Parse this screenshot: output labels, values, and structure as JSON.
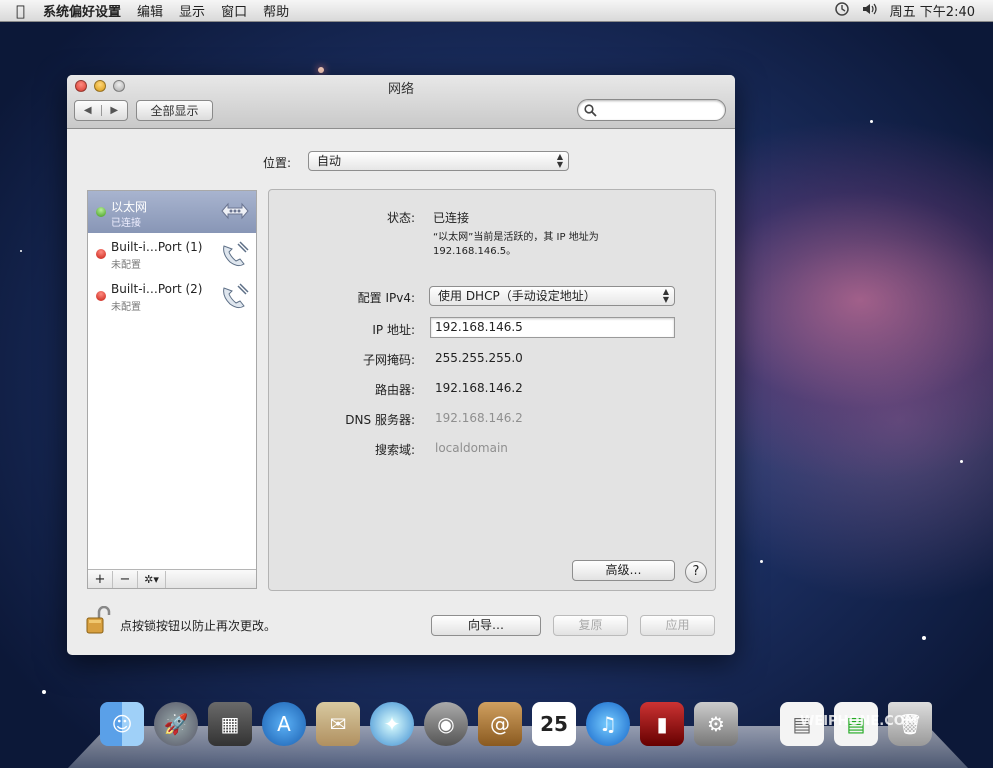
{
  "menubar": {
    "app": "系统偏好设置",
    "items": [
      "编辑",
      "显示",
      "窗口",
      "帮助"
    ],
    "clock": "周五 下午2:40"
  },
  "window": {
    "title": "网络",
    "show_all": "全部显示",
    "search": {
      "placeholder": ""
    }
  },
  "location": {
    "label": "位置:",
    "value": "自动"
  },
  "services": [
    {
      "name": "以太网",
      "status": "已连接",
      "state": "connected"
    },
    {
      "name": "Built-i…Port (1)",
      "status": "未配置",
      "state": "not-configured"
    },
    {
      "name": "Built-i…Port (2)",
      "status": "未配置",
      "state": "not-configured"
    }
  ],
  "sidebar_controls": {
    "add": "+",
    "remove": "−",
    "gear": "✲▾"
  },
  "detail": {
    "status_label": "状态:",
    "status_value": "已连接",
    "status_desc": "“以太网”当前是活跃的，其 IP 地址为 192.168.146.5。",
    "ipv4_label": "配置 IPv4:",
    "ipv4_value": "使用 DHCP（手动设定地址）",
    "ip_label": "IP 地址:",
    "ip_value": "192.168.146.5",
    "subnet_label": "子网掩码:",
    "subnet_value": "255.255.255.0",
    "router_label": "路由器:",
    "router_value": "192.168.146.2",
    "dns_label": "DNS 服务器:",
    "dns_value": "192.168.146.2",
    "search_label": "搜索域:",
    "search_value": "localdomain",
    "advanced": "高级…",
    "help": "?"
  },
  "footer": {
    "lock_text": "点按锁按钮以防止再次更改。",
    "assist": "向导…",
    "revert": "复原",
    "apply": "应用"
  },
  "dock": {
    "calendar_day": "25",
    "watermark": "WEIPHONE.COM"
  },
  "colors": {
    "connected": "#3f9a1a",
    "not_configured": "#c51d12",
    "selection": "#8896b6"
  }
}
